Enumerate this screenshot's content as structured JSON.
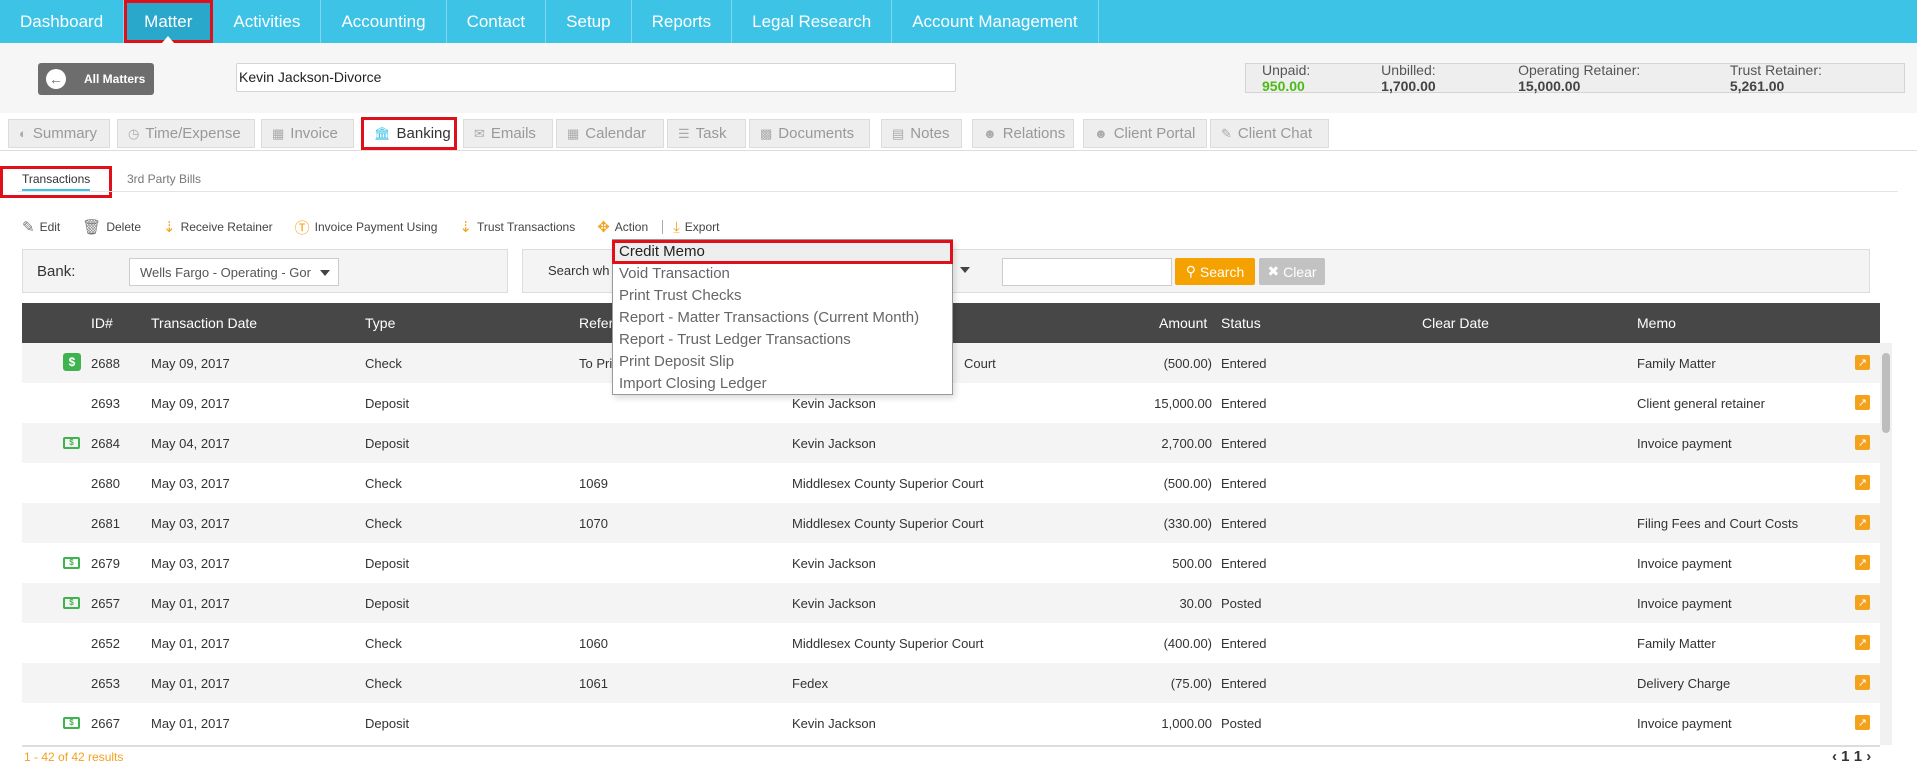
{
  "topnav": {
    "items": [
      "Dashboard",
      "Matter",
      "Activities",
      "Accounting",
      "Contact",
      "Setup",
      "Reports",
      "Legal Research",
      "Account Management"
    ],
    "active": "Matter"
  },
  "header": {
    "all_matters_label": "All Matters",
    "matter_name": "Kevin Jackson-Divorce",
    "unpaid_label": "Unpaid:",
    "unpaid_value": "950.00",
    "unbilled_label": "Unbilled:",
    "unbilled_value": "1,700.00",
    "operating_label": "Operating Retainer:",
    "operating_value": "15,000.00",
    "trust_label": "Trust Retainer:",
    "trust_value": "5,261.00"
  },
  "tabs": [
    {
      "label": "Summary",
      "icon": "dashboard-icon"
    },
    {
      "label": "Time/Expense",
      "icon": "clock-icon"
    },
    {
      "label": "Invoice",
      "icon": "calculator-icon"
    },
    {
      "label": "Banking",
      "icon": "bank-icon"
    },
    {
      "label": "Emails",
      "icon": "envelope-icon"
    },
    {
      "label": "Calendar",
      "icon": "calendar-icon"
    },
    {
      "label": "Task",
      "icon": "tasks-icon"
    },
    {
      "label": "Documents",
      "icon": "folder-icon"
    },
    {
      "label": "Notes",
      "icon": "file-icon"
    },
    {
      "label": "Relations",
      "icon": "users-icon"
    },
    {
      "label": "Client Portal",
      "icon": "client-portal-icon"
    },
    {
      "label": "Client Chat",
      "icon": "chat-icon"
    }
  ],
  "subtabs": {
    "transactions": "Transactions",
    "third_party": "3rd Party Bills"
  },
  "toolbar": {
    "edit": "Edit",
    "delete": "Delete",
    "receive_retainer": "Receive Retainer",
    "invoice_payment": "Invoice Payment Using",
    "trust_transactions": "Trust Transactions",
    "action": "Action",
    "export": "Export"
  },
  "filters": {
    "bank_label": "Bank:",
    "bank_value": "Wells Fargo - Operating - Gor",
    "search_label": "Search wh",
    "search_button": "Search",
    "clear_button": "Clear"
  },
  "action_menu": [
    "Credit Memo",
    "Void Transaction",
    "Print Trust Checks",
    "Report - Matter Transactions (Current Month)",
    "Report - Trust Ledger Transactions",
    "Print Deposit Slip",
    "Import Closing Ledger"
  ],
  "table": {
    "headers": {
      "id": "ID#",
      "date": "Transaction Date",
      "type": "Type",
      "reference": "Refer",
      "amount": "Amount",
      "status": "Status",
      "clear_date": "Clear Date",
      "memo": "Memo"
    },
    "rows": [
      {
        "icon": "s",
        "id": "2688",
        "date": "May 09, 2017",
        "type": "Check",
        "ref": "To Pri",
        "payee": "Court",
        "amount": "(500.00)",
        "status": "Entered",
        "memo": "Family Matter"
      },
      {
        "icon": "",
        "id": "2693",
        "date": "May 09, 2017",
        "type": "Deposit",
        "ref": "",
        "payee": "Kevin Jackson",
        "amount": "15,000.00",
        "status": "Entered",
        "memo": "Client general retainer"
      },
      {
        "icon": "money",
        "id": "2684",
        "date": "May 04, 2017",
        "type": "Deposit",
        "ref": "",
        "payee": "Kevin Jackson",
        "amount": "2,700.00",
        "status": "Entered",
        "memo": "Invoice payment"
      },
      {
        "icon": "",
        "id": "2680",
        "date": "May 03, 2017",
        "type": "Check",
        "ref": "1069",
        "payee": "Middlesex County Superior Court",
        "amount": "(500.00)",
        "status": "Entered",
        "memo": ""
      },
      {
        "icon": "",
        "id": "2681",
        "date": "May 03, 2017",
        "type": "Check",
        "ref": "1070",
        "payee": "Middlesex County Superior Court",
        "amount": "(330.00)",
        "status": "Entered",
        "memo": "Filing Fees and Court Costs"
      },
      {
        "icon": "money",
        "id": "2679",
        "date": "May 03, 2017",
        "type": "Deposit",
        "ref": "",
        "payee": "Kevin Jackson",
        "amount": "500.00",
        "status": "Entered",
        "memo": "Invoice payment"
      },
      {
        "icon": "money",
        "id": "2657",
        "date": "May 01, 2017",
        "type": "Deposit",
        "ref": "",
        "payee": "Kevin Jackson",
        "amount": "30.00",
        "status": "Posted",
        "memo": "Invoice payment"
      },
      {
        "icon": "",
        "id": "2652",
        "date": "May 01, 2017",
        "type": "Check",
        "ref": "1060",
        "payee": "Middlesex County Superior Court",
        "amount": "(400.00)",
        "status": "Entered",
        "memo": "Family Matter"
      },
      {
        "icon": "",
        "id": "2653",
        "date": "May 01, 2017",
        "type": "Check",
        "ref": "1061",
        "payee": "Fedex",
        "amount": "(75.00)",
        "status": "Entered",
        "memo": "Delivery Charge"
      },
      {
        "icon": "money",
        "id": "2667",
        "date": "May 01, 2017",
        "type": "Deposit",
        "ref": "",
        "payee": "Kevin Jackson",
        "amount": "1,000.00",
        "status": "Posted",
        "memo": "Invoice payment"
      }
    ]
  },
  "footer": {
    "results": "1 - 42 of 42 results",
    "page_first": "1",
    "page_current": "1"
  },
  "colors": {
    "nav": "#3cc3e6",
    "accent_orange": "#f5a200",
    "highlight_red": "#e0101a",
    "green": "#4cbb17"
  }
}
